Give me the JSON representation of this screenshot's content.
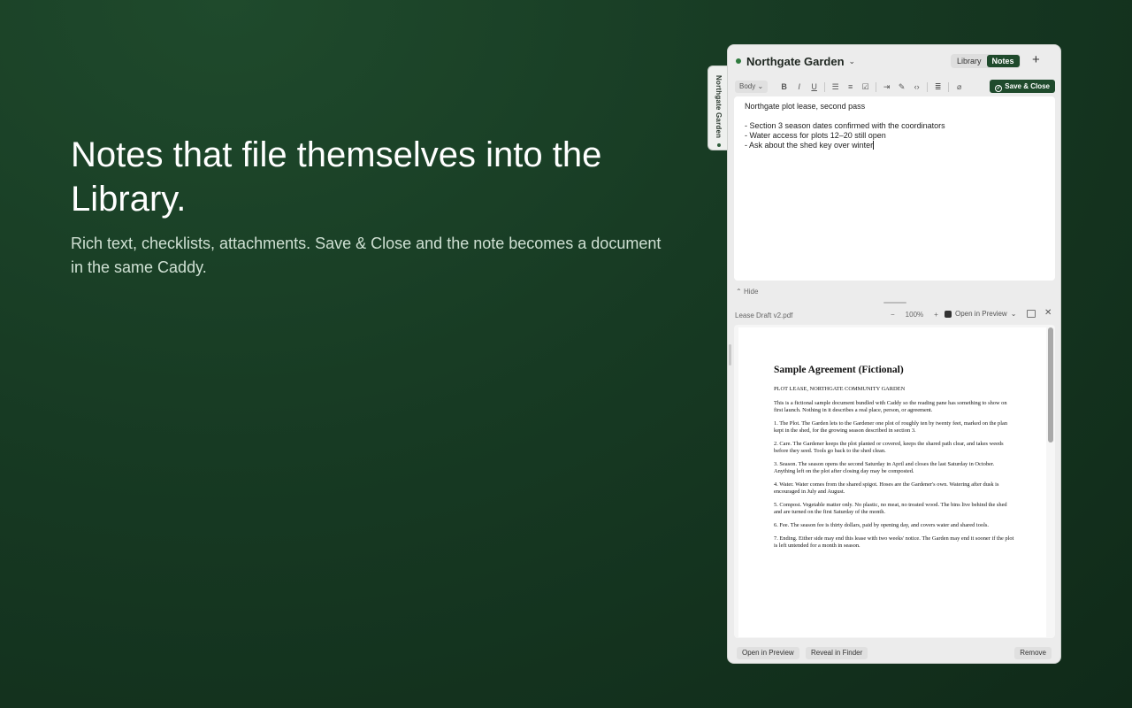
{
  "hero": {
    "title": "Notes that file themselves into the Library.",
    "subtitle": "Rich text, checklists, attachments. Save & Close and the note becomes a document in the same Caddy."
  },
  "sidetab": {
    "label": "Northgate Garden"
  },
  "panel": {
    "workspace": "Northgate Garden",
    "tabs": [
      {
        "label": "Library",
        "active": false
      },
      {
        "label": "Notes",
        "active": true
      }
    ],
    "add_label": "+",
    "toolbar": {
      "style_select": "Body",
      "bold": "B",
      "italic": "I",
      "underline": "U",
      "save_close": "Save & Close"
    },
    "note": {
      "title": "Northgate plot lease, second pass",
      "lines": [
        "- Section 3 season dates confirmed with the coordinators",
        "- Water access for plots 12–20 still open",
        "- Ask about the shed key over winter"
      ]
    },
    "hide_label": "Hide",
    "attachment": {
      "name": "Lease Draft v2.pdf",
      "zoom": "100%",
      "open_in_preview": "Open in Preview"
    },
    "pdf": {
      "title": "Sample Agreement (Fictional)",
      "subtitle": "PLOT LEASE, NORTHGATE COMMUNITY GARDEN",
      "paragraphs": [
        "This is a fictional sample document bundled with Caddy so the reading pane has something to show on first launch. Nothing in it describes a real place, person, or agreement.",
        "1. The Plot. The Garden lets to the Gardener one plot of roughly ten by twenty feet, marked on the plan kept in the shed, for the growing season described in section 3.",
        "2. Care. The Gardener keeps the plot planted or covered, keeps the shared path clear, and takes weeds before they seed. Tools go back to the shed clean.",
        "3. Season. The season opens the second Saturday in April and closes the last Saturday in October. Anything left on the plot after closing day may be composted.",
        "4. Water. Water comes from the shared spigot. Hoses are the Gardener's own. Watering after dusk is encouraged in July and August.",
        "5. Compost. Vegetable matter only. No plastic, no meat, no treated wood. The bins live behind the shed and are turned on the first Saturday of the month.",
        "6. Fee. The season fee is thirty dollars, paid by opening day, and covers water and shared tools.",
        "7. Ending. Either side may end this lease with two weeks' notice. The Garden may end it sooner if the plot is left untended for a month in season."
      ]
    },
    "footer": {
      "open_in_preview": "Open in Preview",
      "reveal_in_finder": "Reveal in Finder",
      "remove": "Remove"
    }
  },
  "colors": {
    "accent": "#1f4a2c",
    "background": "#173a23",
    "status_dot": "#2f7a3e"
  }
}
